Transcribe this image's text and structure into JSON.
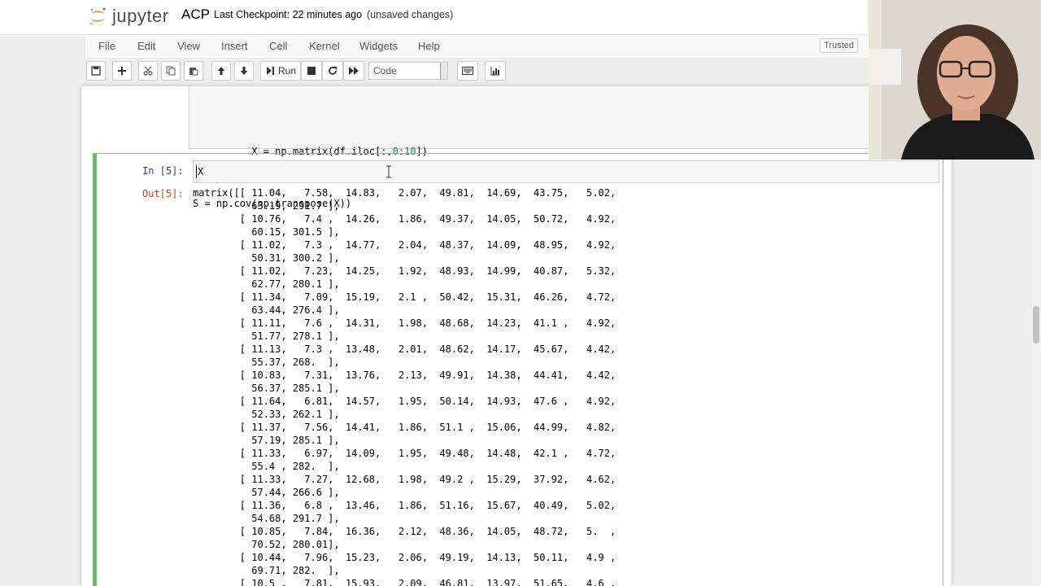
{
  "header": {
    "logo_text": "jupyter",
    "notebook_name": "ACP",
    "checkpoint": "Last Checkpoint: 22 minutes ago",
    "status": "(unsaved changes)"
  },
  "menubar": {
    "items": [
      "File",
      "Edit",
      "View",
      "Insert",
      "Cell",
      "Kernel",
      "Widgets",
      "Help"
    ],
    "trusted": "Trusted"
  },
  "toolbar": {
    "run_label": "Run",
    "cell_type": "Code",
    "icons": [
      "save-icon",
      "plus-icon",
      "cut-icon",
      "copy-icon",
      "paste-icon",
      "arrow-up-icon",
      "arrow-down-icon",
      "run-icon",
      "stop-icon",
      "restart-icon",
      "fast-forward-icon",
      "keyboard-icon",
      "chart-icon"
    ]
  },
  "cells": {
    "previous": {
      "lines": [
        "X = np.matrix(df.iloc[:,0:10])",
        "S = np.cov(np.transpose(X))"
      ]
    },
    "current": {
      "in_prompt": "In [5]:",
      "input": "X",
      "out_prompt": "Out[5]:",
      "output_lines": [
        "matrix([[ 11.04,   7.58,  14.83,   2.07,  49.81,  14.69,  43.75,   5.02,",
        "          63.19, 291.7 ],",
        "        [ 10.76,   7.4 ,  14.26,   1.86,  49.37,  14.05,  50.72,   4.92,",
        "          60.15, 301.5 ],",
        "        [ 11.02,   7.3 ,  14.77,   2.04,  48.37,  14.09,  48.95,   4.92,",
        "          50.31, 300.2 ],",
        "        [ 11.02,   7.23,  14.25,   1.92,  48.93,  14.99,  40.87,   5.32,",
        "          62.77, 280.1 ],",
        "        [ 11.34,   7.09,  15.19,   2.1 ,  50.42,  15.31,  46.26,   4.72,",
        "          63.44, 276.4 ],",
        "        [ 11.11,   7.6 ,  14.31,   1.98,  48.68,  14.23,  41.1 ,   4.92,",
        "          51.77, 278.1 ],",
        "        [ 11.13,   7.3 ,  13.48,   2.01,  48.62,  14.17,  45.67,   4.42,",
        "          55.37, 268.  ],",
        "        [ 10.83,   7.31,  13.76,   2.13,  49.91,  14.38,  44.41,   4.42,",
        "          56.37, 285.1 ],",
        "        [ 11.64,   6.81,  14.57,   1.95,  50.14,  14.93,  47.6 ,   4.92,",
        "          52.33, 262.1 ],",
        "        [ 11.37,   7.56,  14.41,   1.86,  51.1 ,  15.06,  44.99,   4.82,",
        "          57.19, 285.1 ],",
        "        [ 11.33,   6.97,  14.09,   1.95,  49.48,  14.48,  42.1 ,   4.72,",
        "          55.4 , 282.  ],",
        "        [ 11.33,   7.27,  12.68,   1.98,  49.2 ,  15.29,  37.92,   4.62,",
        "          57.44, 266.6 ],",
        "        [ 11.36,   6.8 ,  13.46,   1.86,  51.16,  15.67,  40.49,   5.02,",
        "          54.68, 291.7 ],",
        "        [ 10.85,   7.84,  16.36,   2.12,  48.36,  14.05,  48.72,   5.  ,",
        "          70.52, 280.01],",
        "        [ 10.44,   7.96,  15.23,   2.06,  49.19,  14.13,  50.11,   4.9 ,",
        "          69.71, 282.  ],",
        "        [ 10.5 ,   7.81,  15.93,   2.09,  46.81,  13.97,  51.65,   4.6 ,"
      ]
    }
  },
  "colors": {
    "selected_cell_border": "#66bb6a",
    "in_prompt": "#303f9f",
    "out_prompt": "#d84315",
    "logo_orange": "#f37726"
  }
}
